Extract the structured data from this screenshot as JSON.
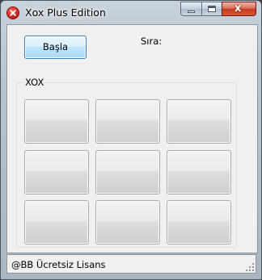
{
  "window": {
    "title": "Xox Plus Edition",
    "icon": "error-red-x-icon",
    "controls": {
      "minimize": "minimize",
      "maximize": "maximize",
      "close": "x"
    }
  },
  "toolbar": {
    "start_label": "Başla",
    "turn_label": "Sıra:"
  },
  "board": {
    "group_title": "XOX",
    "cells": [
      "",
      "",
      "",
      "",
      "",
      "",
      "",
      "",
      ""
    ]
  },
  "status": {
    "text": "@BB Ücretsiz Lisans"
  }
}
